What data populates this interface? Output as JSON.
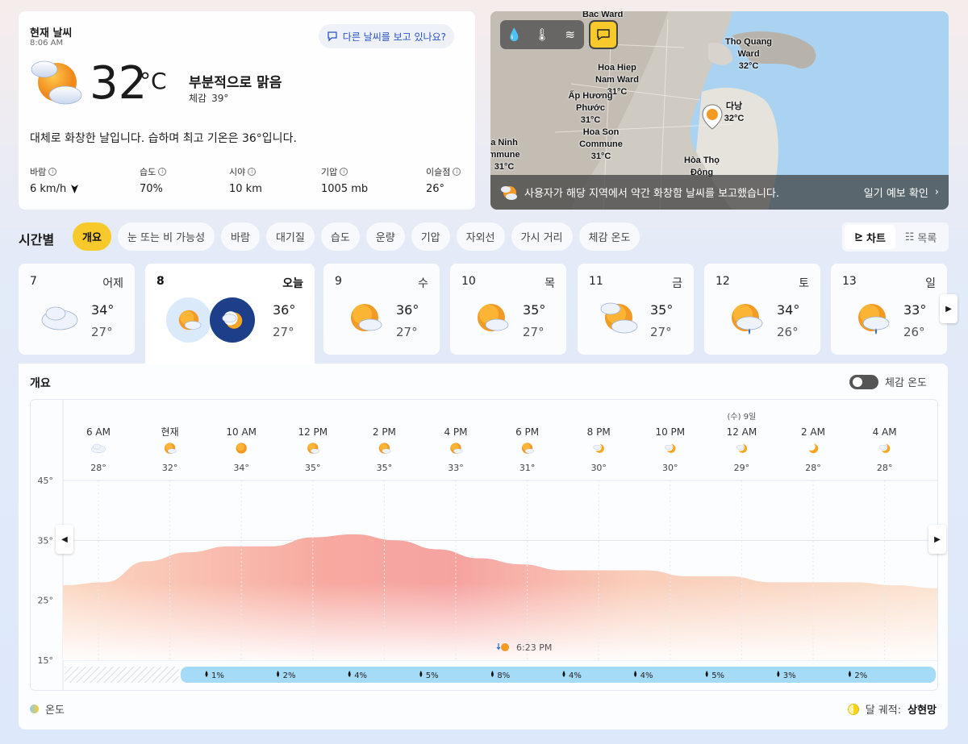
{
  "current": {
    "title": "현재 날씨",
    "time": "8:06 AM",
    "report_button": "다른 날씨를 보고 있나요?",
    "temp": "32",
    "unit": "°C",
    "condition": "부분적으로 맑음",
    "feels_label": "체감",
    "feels_value": "39°",
    "summary": "대체로 화창한 날입니다. 습하며 최고 기온은 36°입니다.",
    "stats": [
      {
        "label": "바람",
        "value": "6 km/h"
      },
      {
        "label": "습도",
        "value": "70%"
      },
      {
        "label": "시야",
        "value": "10 km"
      },
      {
        "label": "기압",
        "value": "1005 mb"
      },
      {
        "label": "이슬점",
        "value": "26°"
      }
    ]
  },
  "map": {
    "places": [
      {
        "name": "Bac Ward",
        "temp": ""
      },
      {
        "name": "Tho Quang Ward",
        "temp": "32°C"
      },
      {
        "name": "Hoa Hiep Nam Ward",
        "temp": "31°C"
      },
      {
        "name": "Ấp Hương Phước",
        "temp": "31°C"
      },
      {
        "name": "다낭",
        "temp": "32°C"
      },
      {
        "name": "Hoa Son Commune",
        "temp": "31°C"
      },
      {
        "name": "a Ninh mmune",
        "temp": "31°C"
      },
      {
        "name": "Hòa Thọ Đông",
        "temp": ""
      }
    ],
    "footer_text": "사용자가 해당 지역에서 약간 화창함 날씨를 보고했습니다.",
    "footer_link": "일기 예보 확인"
  },
  "hourly": {
    "title": "시간별",
    "pills": [
      "개요",
      "눈 또는 비 가능성",
      "바람",
      "대기질",
      "습도",
      "운량",
      "기압",
      "자외선",
      "가시 거리",
      "체감 온도"
    ],
    "view_chart": "차트",
    "view_list": "목록"
  },
  "days": [
    {
      "num": "7",
      "name": "어제",
      "hi": "34°",
      "lo": "27°",
      "icon": "cloudy-icon"
    },
    {
      "num": "8",
      "name": "오늘",
      "hi": "36°",
      "lo": "27°",
      "icon": "partly-sunny-icon"
    },
    {
      "num": "9",
      "name": "수",
      "hi": "36°",
      "lo": "27°",
      "icon": "partly-sunny-icon"
    },
    {
      "num": "10",
      "name": "목",
      "hi": "35°",
      "lo": "27°",
      "icon": "partly-sunny-icon"
    },
    {
      "num": "11",
      "name": "금",
      "hi": "35°",
      "lo": "27°",
      "icon": "mostly-cloudy-icon"
    },
    {
      "num": "12",
      "name": "토",
      "hi": "34°",
      "lo": "26°",
      "icon": "rain-showers-icon"
    },
    {
      "num": "13",
      "name": "일",
      "hi": "33°",
      "lo": "26°",
      "icon": "rain-showers-icon"
    }
  ],
  "overview": {
    "title": "개요",
    "feels_toggle": "체감 온도",
    "legend_temp": "온도",
    "moon_label": "달 궤적:",
    "moon_phase": "상현망",
    "sunset": "6:23 PM",
    "day_label": "(수) 9일"
  },
  "chart_data": {
    "type": "area",
    "title": "",
    "ylabel": "",
    "ylim": [
      15,
      45
    ],
    "yticks": [
      "15°",
      "25°",
      "35°",
      "45°"
    ],
    "hour_labels": [
      "6 AM",
      "현재",
      "10 AM",
      "12 PM",
      "2 PM",
      "4 PM",
      "6 PM",
      "8 PM",
      "10 PM",
      "12 AM",
      "2 AM",
      "4 AM"
    ],
    "hour_temps": [
      "28°",
      "32°",
      "34°",
      "35°",
      "35°",
      "33°",
      "31°",
      "30°",
      "30°",
      "29°",
      "28°",
      "28°"
    ],
    "hour_icons": [
      "cloudy-icon",
      "partly-sunny-icon",
      "sunny-icon",
      "partly-sunny-icon",
      "partly-sunny-icon",
      "partly-sunny-icon",
      "partly-sunny-icon",
      "partly-cloudy-night-icon",
      "partly-cloudy-night-icon",
      "partly-cloudy-night-icon",
      "clear-night-icon",
      "partly-cloudy-night-icon"
    ],
    "series_values": [
      27.5,
      28,
      31.5,
      33,
      34,
      34,
      35.5,
      36,
      35,
      33.5,
      32,
      31,
      30,
      30,
      30,
      29,
      29,
      28,
      28,
      28,
      27.5,
      27
    ],
    "precip": [
      "1%",
      "2%",
      "4%",
      "5%",
      "8%",
      "4%",
      "4%",
      "5%",
      "3%",
      "2%"
    ]
  }
}
